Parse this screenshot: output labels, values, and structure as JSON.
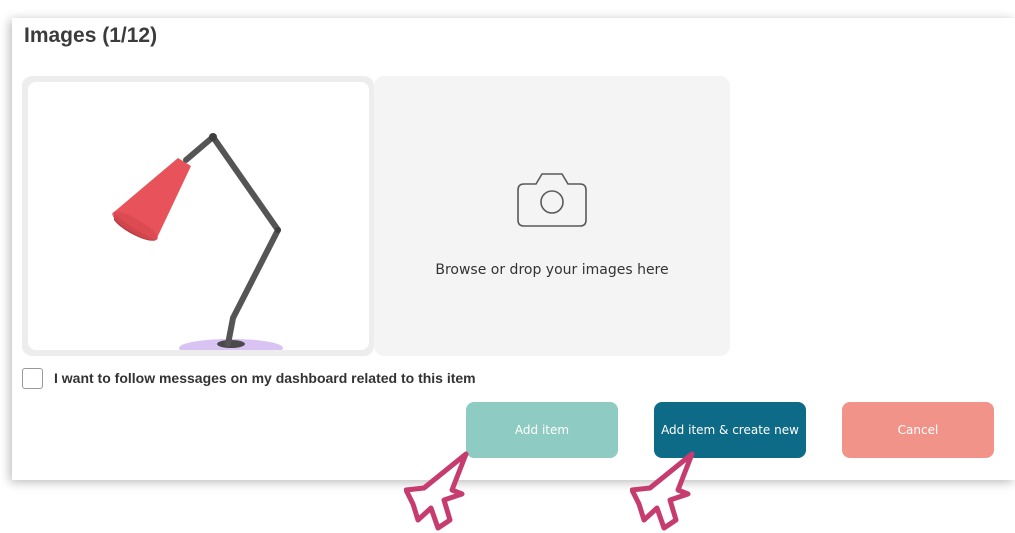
{
  "section": {
    "title": "Images (1/12)"
  },
  "images": {
    "thumbnail_icon": "desk-lamp-image",
    "dropzone_icon": "camera-icon",
    "dropzone_text": "Browse or drop your images here"
  },
  "follow": {
    "checked": false,
    "label": "I want to follow messages on my dashboard related to this item"
  },
  "actions": {
    "add_label": "Add item",
    "add_new_label": "Add item & create new",
    "cancel_label": "Cancel"
  },
  "colors": {
    "add": "#8ecbc2",
    "add_new": "#0e6b88",
    "cancel": "#f2938a",
    "cursor_outline": "#c63c6f"
  }
}
